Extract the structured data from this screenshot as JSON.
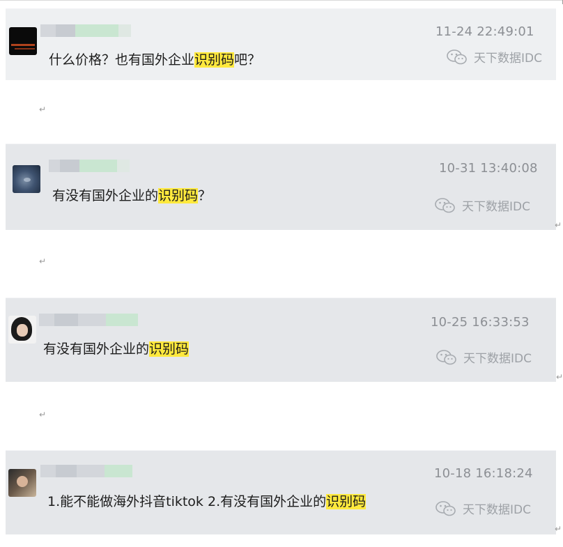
{
  "cards": [
    {
      "timestamp": "11-24 22:49:01",
      "text_before": "什么价格？也有国外企业",
      "highlight": "识别码",
      "text_after": "吧？",
      "source": "天下数据IDC"
    },
    {
      "timestamp": "10-31 13:40:08",
      "text_before": "有没有国外企业的",
      "highlight": "识别码",
      "text_after": "？",
      "source": "天下数据IDC"
    },
    {
      "timestamp": "10-25 16:33:53",
      "text_before": "有没有国外企业的",
      "highlight": "识别码",
      "text_after": "",
      "source": "天下数据IDC"
    },
    {
      "timestamp": "10-18 16:18:24",
      "text_before": "1.能不能做海外抖音tiktok 2.有没有国外企业的",
      "highlight": "识别码",
      "text_after": "",
      "source": "天下数据IDC"
    }
  ],
  "paragraph_mark": "↵",
  "icons": {
    "avatar": "user-avatar",
    "source": "wechat-icon",
    "mark": "paragraph-return-mark"
  },
  "colors": {
    "highlight": "#ffe93d",
    "card_bg": "#e5e7ea",
    "timestamp": "#8c8f94",
    "source": "#9da1a6"
  }
}
